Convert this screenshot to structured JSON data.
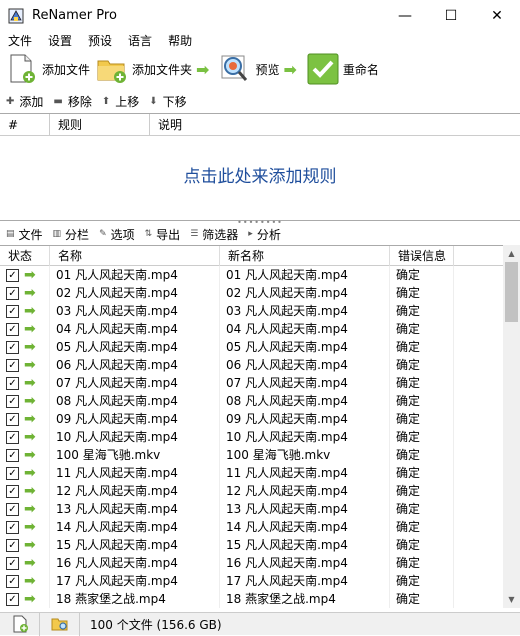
{
  "window": {
    "title": "ReNamer Pro",
    "minimize": "—",
    "maximize": "☐",
    "close": "✕"
  },
  "menu": [
    "文件",
    "设置",
    "预设",
    "语言",
    "帮助"
  ],
  "toolbar": {
    "add_files": "添加文件",
    "add_folder": "添加文件夹",
    "preview": "预览",
    "rename": "重命名"
  },
  "rule_bar": {
    "add": "添加",
    "remove": "移除",
    "up": "上移",
    "down": "下移"
  },
  "rules": {
    "col_num": "#",
    "col_rule": "规则",
    "col_desc": "说明",
    "placeholder": "点击此处来添加规则"
  },
  "file_bar": {
    "files": "文件",
    "columns": "分栏",
    "options": "选项",
    "export": "导出",
    "filter": "筛选器",
    "analyze": "分析"
  },
  "files": {
    "col_status": "状态",
    "col_name": "名称",
    "col_new": "新名称",
    "col_error": "错误信息",
    "rows": [
      {
        "name": "01 凡人风起天南.mp4",
        "new": "01 凡人风起天南.mp4",
        "err": "确定"
      },
      {
        "name": "02 凡人风起天南.mp4",
        "new": "02 凡人风起天南.mp4",
        "err": "确定"
      },
      {
        "name": "03 凡人风起天南.mp4",
        "new": "03 凡人风起天南.mp4",
        "err": "确定"
      },
      {
        "name": "04 凡人风起天南.mp4",
        "new": "04 凡人风起天南.mp4",
        "err": "确定"
      },
      {
        "name": "05 凡人风起天南.mp4",
        "new": "05 凡人风起天南.mp4",
        "err": "确定"
      },
      {
        "name": "06 凡人风起天南.mp4",
        "new": "06 凡人风起天南.mp4",
        "err": "确定"
      },
      {
        "name": "07 凡人风起天南.mp4",
        "new": "07 凡人风起天南.mp4",
        "err": "确定"
      },
      {
        "name": "08 凡人风起天南.mp4",
        "new": "08 凡人风起天南.mp4",
        "err": "确定"
      },
      {
        "name": "09 凡人风起天南.mp4",
        "new": "09 凡人风起天南.mp4",
        "err": "确定"
      },
      {
        "name": "10 凡人风起天南.mp4",
        "new": "10 凡人风起天南.mp4",
        "err": "确定"
      },
      {
        "name": "100 星海飞驰.mkv",
        "new": "100 星海飞驰.mkv",
        "err": "确定"
      },
      {
        "name": "11 凡人风起天南.mp4",
        "new": "11 凡人风起天南.mp4",
        "err": "确定"
      },
      {
        "name": "12 凡人风起天南.mp4",
        "new": "12 凡人风起天南.mp4",
        "err": "确定"
      },
      {
        "name": "13 凡人风起天南.mp4",
        "new": "13 凡人风起天南.mp4",
        "err": "确定"
      },
      {
        "name": "14 凡人风起天南.mp4",
        "new": "14 凡人风起天南.mp4",
        "err": "确定"
      },
      {
        "name": "15 凡人风起天南.mp4",
        "new": "15 凡人风起天南.mp4",
        "err": "确定"
      },
      {
        "name": "16 凡人风起天南.mp4",
        "new": "16 凡人风起天南.mp4",
        "err": "确定"
      },
      {
        "name": "17 凡人风起天南.mp4",
        "new": "17 凡人风起天南.mp4",
        "err": "确定"
      },
      {
        "name": "18 燕家堡之战.mp4",
        "new": "18 燕家堡之战.mp4",
        "err": "确定"
      }
    ]
  },
  "status": {
    "summary": "100 个文件 (156.6 GB)"
  },
  "colors": {
    "accent_green": "#6fb335",
    "placeholder_blue": "#1f4e9c"
  }
}
